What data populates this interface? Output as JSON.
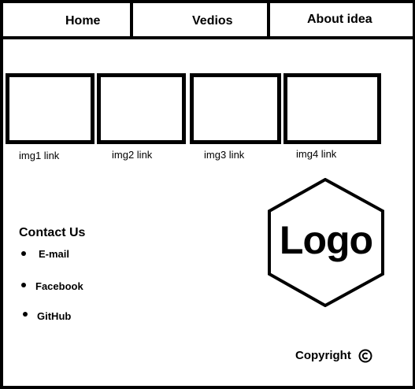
{
  "nav": {
    "items": [
      {
        "label": "Home",
        "icon": ""
      },
      {
        "label": "Vedios",
        "icon": ""
      },
      {
        "label": "About idea",
        "icon": ""
      }
    ]
  },
  "gallery": {
    "items": [
      {
        "link_label": "img1 link"
      },
      {
        "link_label": "img2 link"
      },
      {
        "link_label": "img3 link"
      },
      {
        "link_label": "img4 link"
      }
    ]
  },
  "contact": {
    "title": "Contact Us",
    "links": [
      "E-mail",
      "Facebook",
      "GitHub"
    ]
  },
  "logo": {
    "text": "Logo",
    "icon": "hexagon-logo-icon"
  },
  "footer": {
    "copyright_label": "Copyright",
    "copyright_icon": "copyright-icon"
  },
  "colors": {
    "foreground": "#000000",
    "background": "#ffffff"
  }
}
